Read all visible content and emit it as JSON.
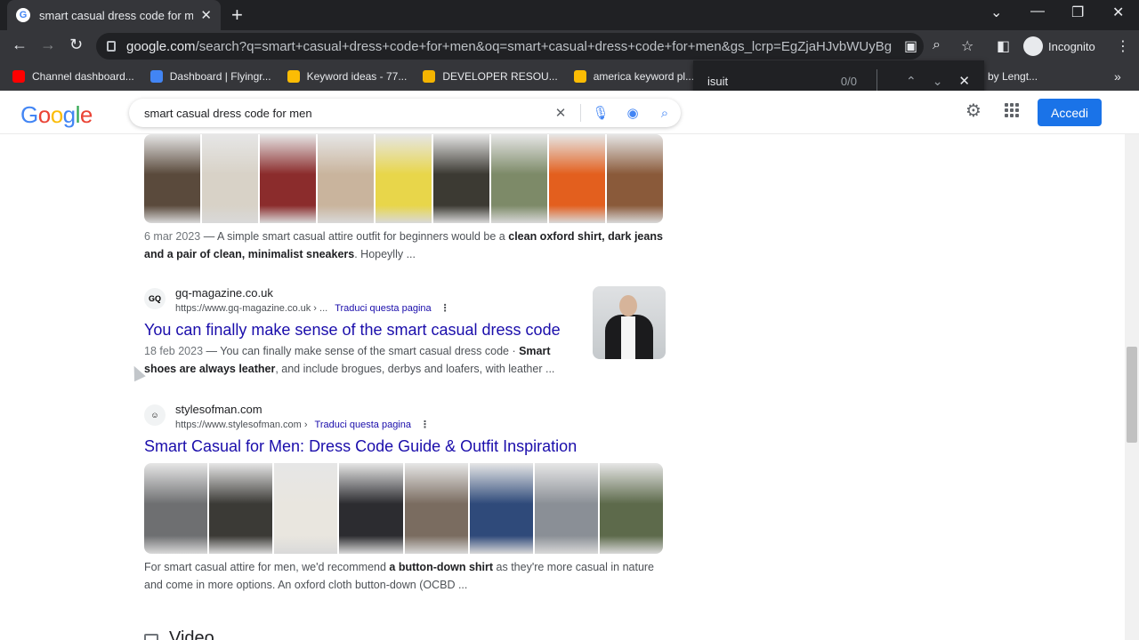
{
  "browser": {
    "tab_title": "smart casual dress code for men",
    "url_host": "google.com",
    "url_path": "/search?q=smart+casual+dress+code+for+men&oq=smart+casual+dress+code+for+men&gs_lcrp=EgZjaHJvbWUyBggAEEU...",
    "profile_label": "Incognito",
    "bookmarks": [
      {
        "label": "Channel dashboard...",
        "color": "#ff0000"
      },
      {
        "label": "Dashboard | Flyingr...",
        "color": "#4285f4"
      },
      {
        "label": "Keyword ideas - 77...",
        "color": "#fbbc04"
      },
      {
        "label": "DEVELOPER RESOU...",
        "color": "#f4b400"
      },
      {
        "label": "america keyword pl...",
        "color": "#fbbc04"
      }
    ],
    "bookmark_overflow": "by Lengt...",
    "find": {
      "query": "isuit",
      "count": "0/0"
    }
  },
  "google": {
    "logo_letters": [
      "G",
      "o",
      "o",
      "g",
      "l",
      "e"
    ],
    "logo_colors": [
      "#4285f4",
      "#ea4335",
      "#fbbc05",
      "#4285f4",
      "#34a853",
      "#ea4335"
    ],
    "query": "smart casual dress code for men",
    "signin_label": "Accedi"
  },
  "results": {
    "first_snippet": {
      "date": "6 mar 2023",
      "parts": [
        {
          "t": " — A simple smart casual attire outfit for beginners would be a ",
          "b": false
        },
        {
          "t": "clean oxford shirt, dark jeans and a pair of clean, minimalist sneakers",
          "b": true
        },
        {
          "t": ". Hopeylly ...",
          "b": false
        }
      ]
    },
    "gq": {
      "site_name": "gq-magazine.co.uk",
      "site_url": "https://www.gq-magazine.co.uk › ...",
      "translate": "Traduci questa pagina",
      "title": "You can finally make sense of the smart casual dress code",
      "date": "18 feb 2023",
      "parts": [
        {
          "t": " — You can finally make sense of the smart casual dress code · ",
          "b": false
        },
        {
          "t": "Smart shoes are always leather",
          "b": true
        },
        {
          "t": ", and include brogues, derbys and loafers, with leather ...",
          "b": false
        }
      ]
    },
    "som": {
      "site_name": "stylesofman.com",
      "site_url": "https://www.stylesofman.com ›",
      "translate": "Traduci questa pagina",
      "title": "Smart Casual for Men: Dress Code Guide & Outfit Inspiration",
      "parts": [
        {
          "t": "For smart casual attire for men, we'd recommend ",
          "b": false
        },
        {
          "t": "a button-down shirt",
          "b": true
        },
        {
          "t": " as they're more casual in nature and come in more options. An oxford cloth button-down (OCBD ...",
          "b": false
        }
      ]
    },
    "next_section": "Video",
    "strip1_colors": [
      "#5a4a3c",
      "#d8d2c7",
      "#8b2c2c",
      "#c9b49d",
      "#e8d64a",
      "#3c3a33",
      "#7d8a68",
      "#e35f1e",
      "#8a5a3a"
    ],
    "strip2_colors": [
      "#6e6f71",
      "#3b3a36",
      "#e9e6df",
      "#2c2c30",
      "#7a6c60",
      "#2f4a7a",
      "#8a8f96",
      "#5d6a4b"
    ]
  }
}
